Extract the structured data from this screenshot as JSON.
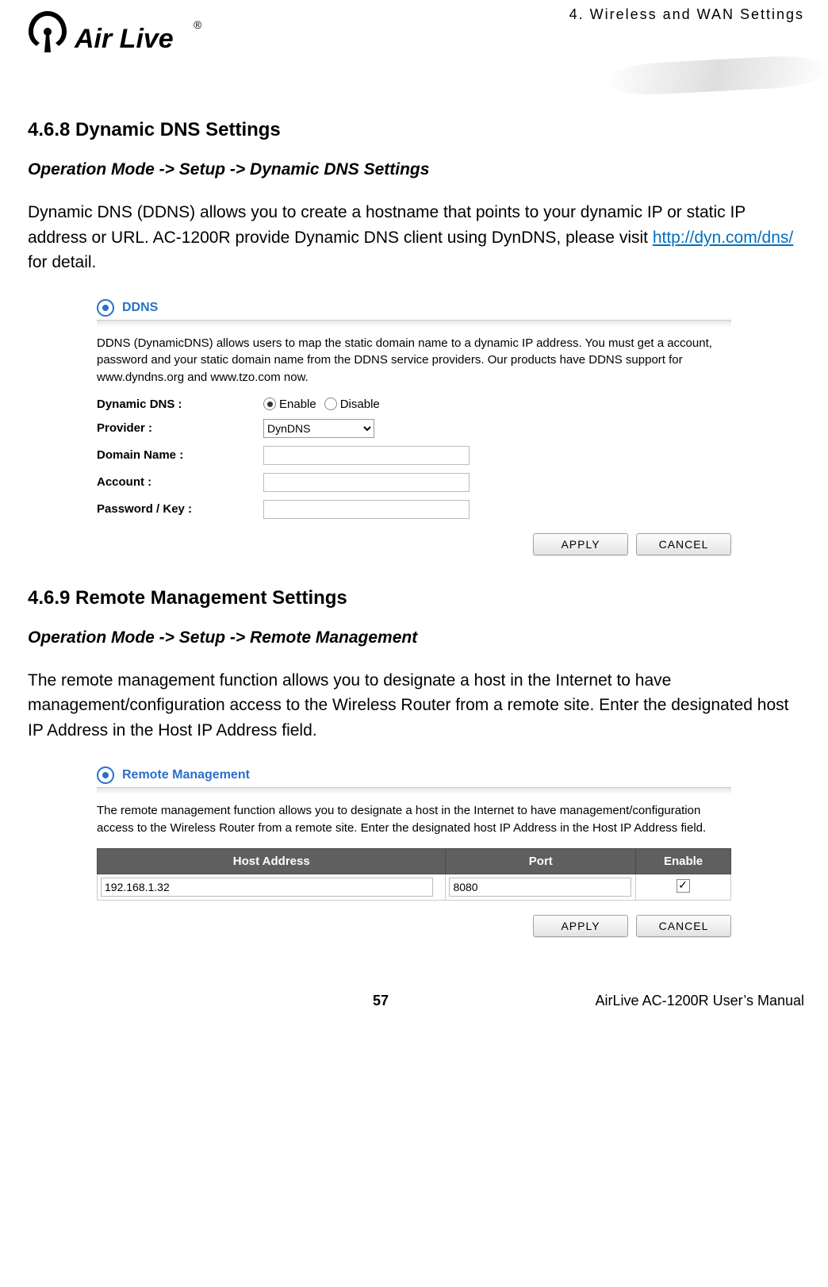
{
  "header": {
    "chapter": "4.  Wireless  and  WAN  Settings",
    "logo_text_main": "Air Live",
    "logo_text_r": "®"
  },
  "section1": {
    "heading": "4.6.8 Dynamic DNS Settings",
    "breadcrumb": "Operation Mode -> Setup -> Dynamic DNS Settings",
    "desc_before_link": "Dynamic DNS (DDNS) allows you to create a hostname that points to your dynamic IP or static IP address or URL. AC-1200R provide Dynamic DNS client using DynDNS, please visit ",
    "link_text": "http://dyn.com/dns/",
    "desc_after_link": " for detail.",
    "panel": {
      "title": "DDNS",
      "help": "DDNS (DynamicDNS) allows users to map the static domain name to a dynamic IP address. You must get a account, password and your static domain name from the DDNS service providers. Our products have DDNS support for www.dyndns.org and www.tzo.com now.",
      "rows": {
        "ddns_label": "Dynamic DNS :",
        "enable": "Enable",
        "disable": "Disable",
        "provider_label": "Provider :",
        "provider_value": "DynDNS",
        "domain_label": "Domain Name :",
        "domain_value": "",
        "account_label": "Account :",
        "account_value": "",
        "password_label": "Password / Key :",
        "password_value": ""
      },
      "buttons": {
        "apply": "APPLY",
        "cancel": "CANCEL"
      }
    }
  },
  "section2": {
    "heading": "4.6.9 Remote Management Settings",
    "breadcrumb": "Operation Mode -> Setup -> Remote Management",
    "desc": "The remote management function allows you to designate a host in the Internet to have management/configuration access to the Wireless Router from a remote site. Enter the designated host IP Address in the Host IP Address field.",
    "panel": {
      "title": "Remote Management",
      "help": "The remote management function allows you to designate a host in the Internet to have management/configuration access to the Wireless Router from a remote site. Enter the designated host IP Address in the Host IP Address field.",
      "table": {
        "headers": [
          "Host Address",
          "Port",
          "Enable"
        ],
        "row": {
          "host": "192.168.1.32",
          "port": "8080",
          "enable": true
        }
      },
      "buttons": {
        "apply": "APPLY",
        "cancel": "CANCEL"
      }
    }
  },
  "footer": {
    "page": "57",
    "manual": "AirLive AC-1200R User’s Manual"
  }
}
